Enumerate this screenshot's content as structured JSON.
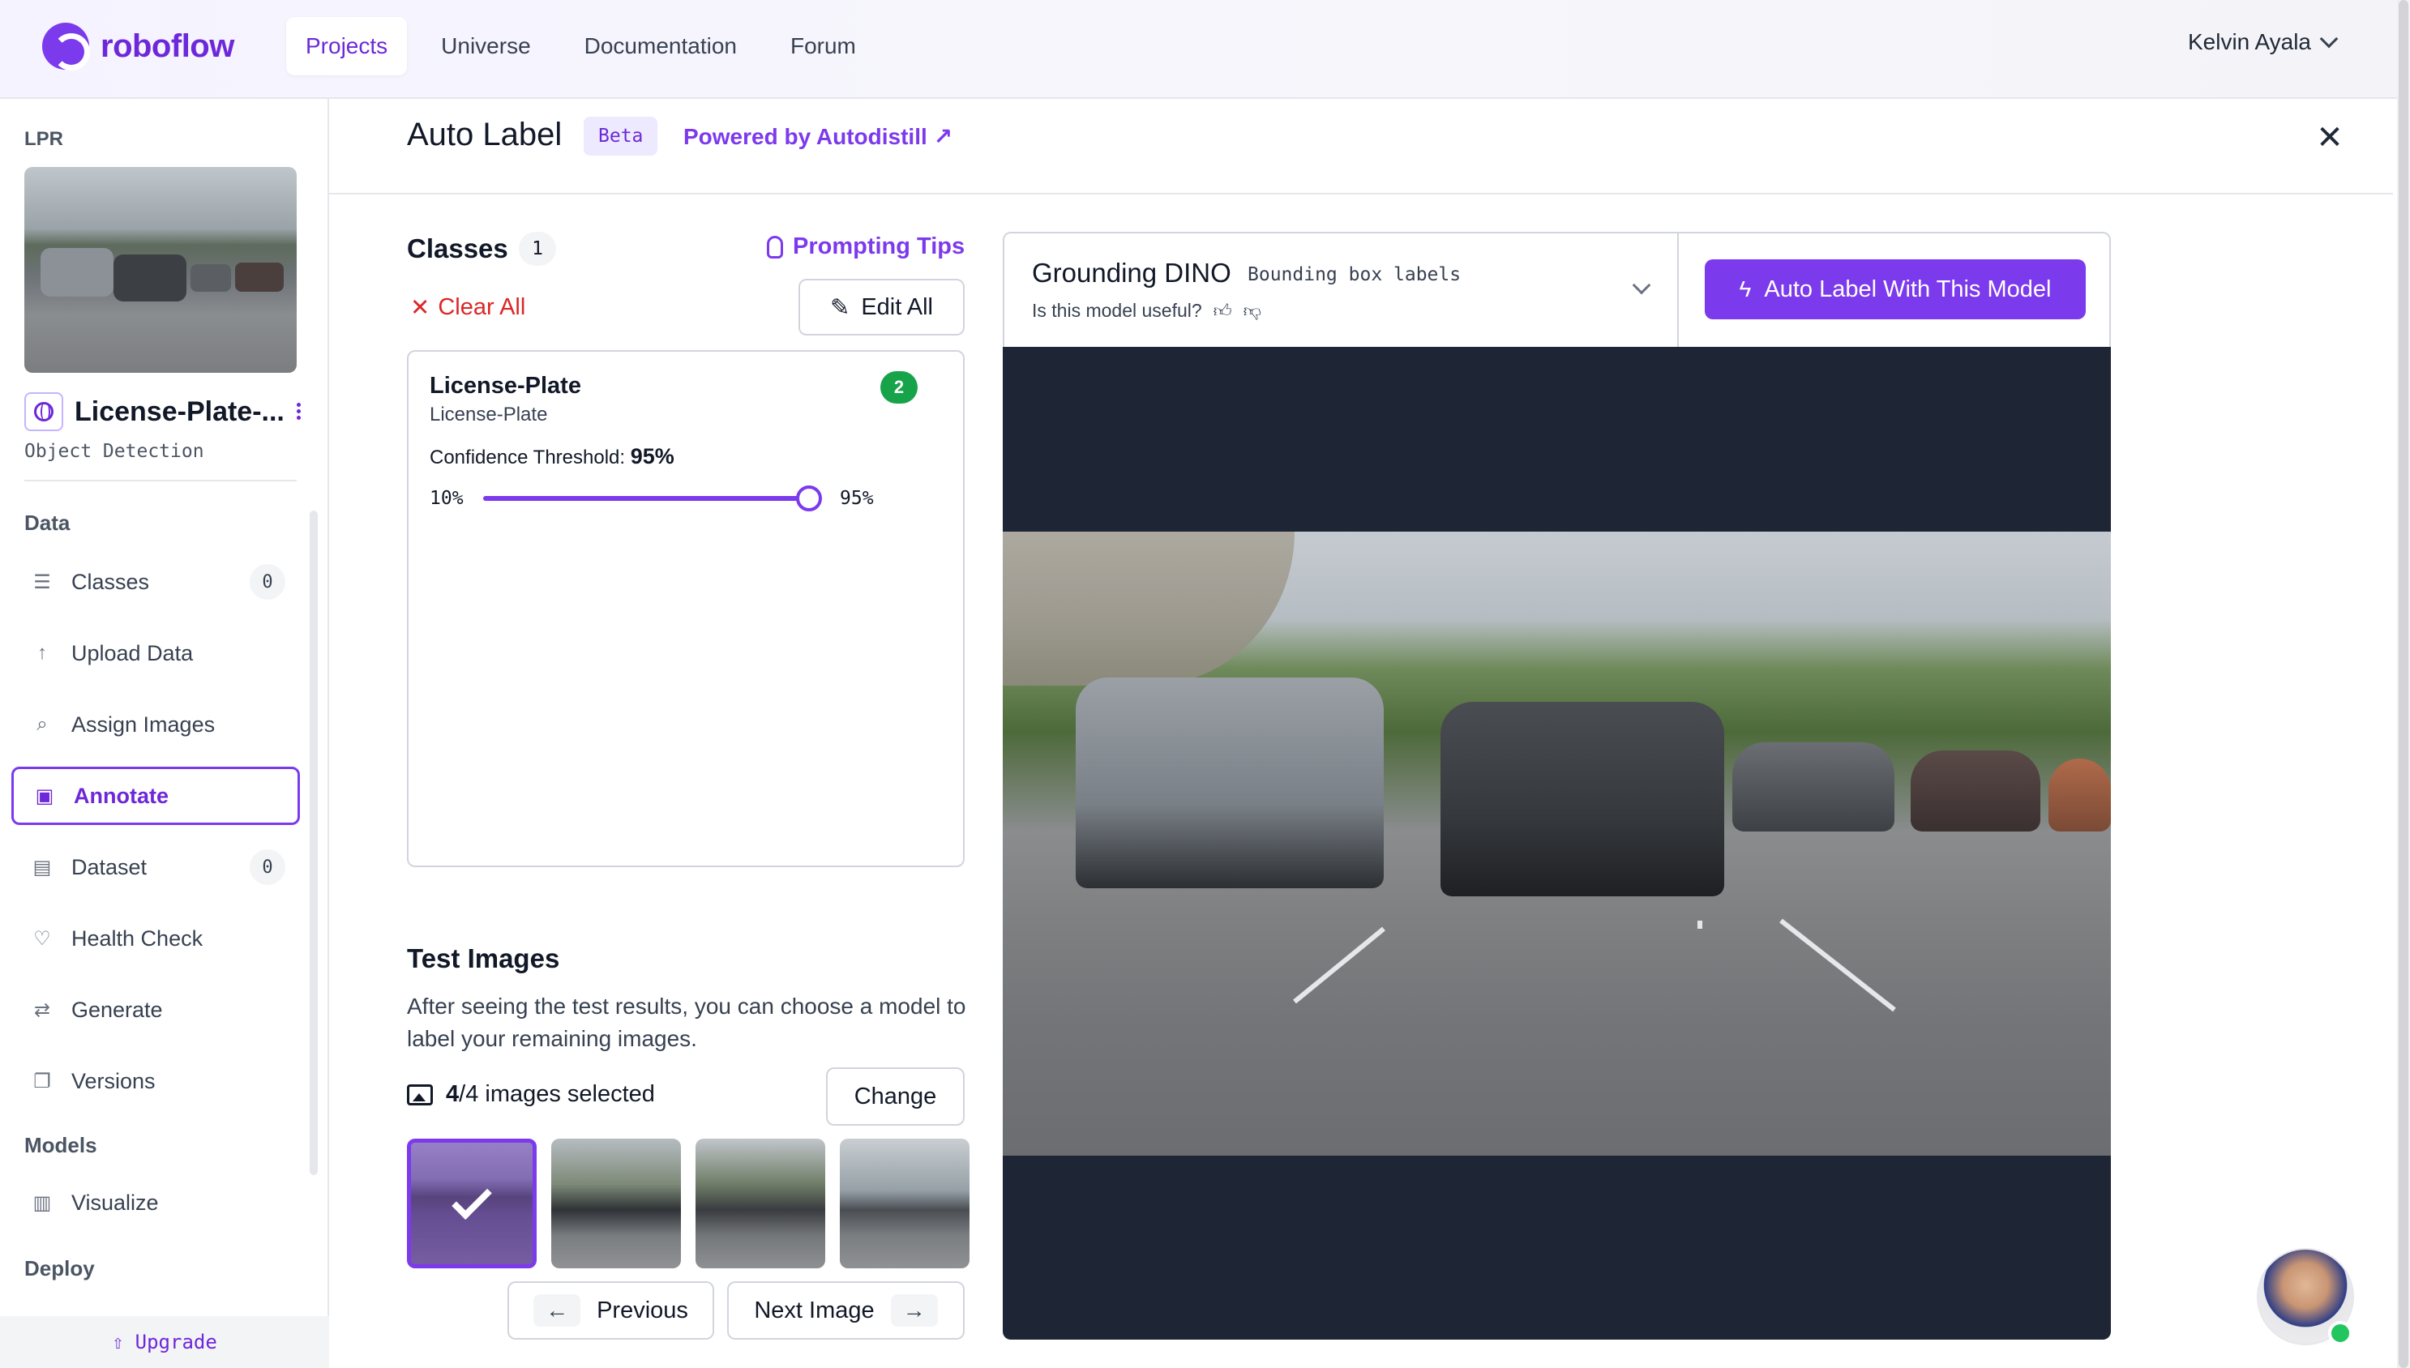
{
  "brand": {
    "name": "roboflow",
    "accent": "#7c3aed"
  },
  "nav": {
    "items": [
      {
        "label": "Projects",
        "active": true
      },
      {
        "label": "Universe"
      },
      {
        "label": "Documentation"
      },
      {
        "label": "Forum"
      }
    ],
    "user": "Kelvin Ayala"
  },
  "sidebar": {
    "project_label": "LPR",
    "project_name": "License-Plate-...",
    "project_type": "Object Detection",
    "sections": {
      "data": "Data",
      "models": "Models",
      "deploy": "Deploy"
    },
    "items": [
      {
        "label": "Classes",
        "icon": "list-icon",
        "count": "0"
      },
      {
        "label": "Upload Data",
        "icon": "upload-icon"
      },
      {
        "label": "Assign Images",
        "icon": "search-icon"
      },
      {
        "label": "Annotate",
        "icon": "annotate-icon",
        "active": true
      },
      {
        "label": "Dataset",
        "icon": "dataset-icon",
        "count": "0"
      },
      {
        "label": "Health Check",
        "icon": "health-icon"
      },
      {
        "label": "Generate",
        "icon": "generate-icon"
      },
      {
        "label": "Versions",
        "icon": "versions-icon"
      },
      {
        "label": "Visualize",
        "icon": "chart-icon"
      }
    ],
    "upgrade": "Upgrade"
  },
  "panel": {
    "title": "Auto Label",
    "badge": "Beta",
    "powered_by": "Powered by Autodistill ↗"
  },
  "classes": {
    "heading": "Classes",
    "count": "1",
    "tips": "Prompting Tips",
    "clear_all": "Clear All",
    "edit_all": "Edit All",
    "card": {
      "name": "License-Plate",
      "prompt": "License-Plate",
      "badge": "2",
      "threshold_label": "Confidence Threshold:",
      "threshold_value": "95%",
      "slider_min": "10%",
      "slider_max": "95%",
      "slider_fraction": 1.0
    }
  },
  "test_images": {
    "heading": "Test Images",
    "description": "After seeing the test results, you can choose a model to label your remaining images.",
    "selected_count": "4",
    "selected_total": "/4 images selected",
    "change": "Change",
    "previous": "Previous",
    "next": "Next Image"
  },
  "model": {
    "name": "Grounding DINO",
    "type": "Bounding box labels",
    "useful_q": "Is this model useful?",
    "auto_label_btn": "Auto Label With This Model"
  }
}
